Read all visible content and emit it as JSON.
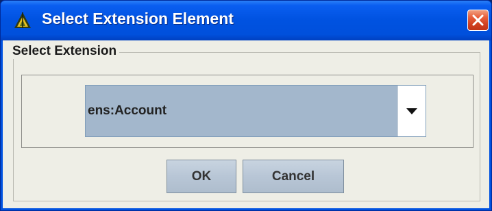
{
  "window": {
    "title": "Select Extension Element",
    "icon": "java-app-icon",
    "close_icon": "close-icon"
  },
  "group": {
    "legend": "Select Extension"
  },
  "combo": {
    "selected": "ens:Account",
    "arrow_icon": "chevron-down-icon"
  },
  "buttons": {
    "ok": "OK",
    "cancel": "Cancel"
  },
  "colors": {
    "titlebar": "#0052e0",
    "client_bg": "#eeeee6",
    "combo_selected_bg": "#a3b7cc",
    "close_button": "#d04020"
  }
}
